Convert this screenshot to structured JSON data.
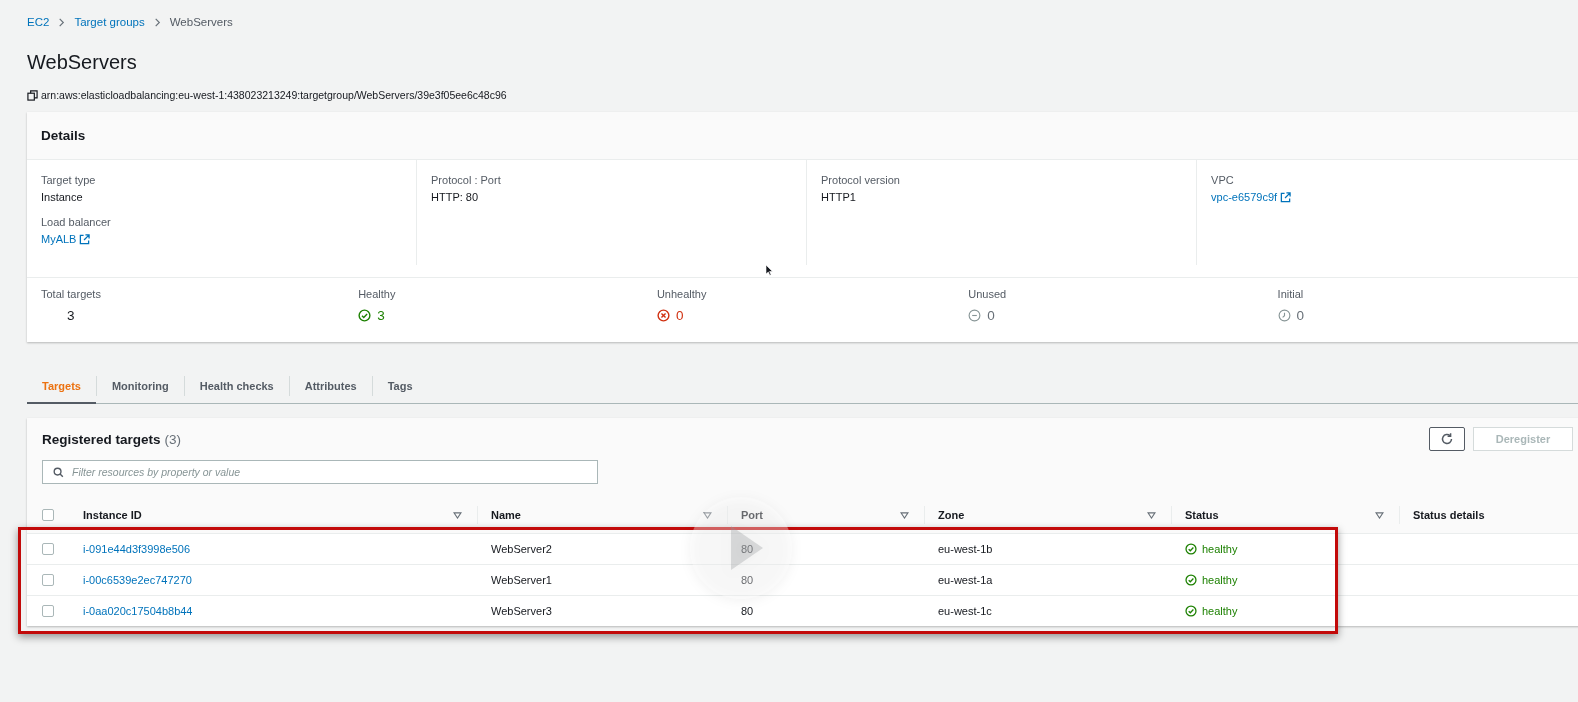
{
  "breadcrumbs": [
    {
      "label": "EC2",
      "kind": "link"
    },
    {
      "label": "Target groups",
      "kind": "link"
    },
    {
      "label": "WebServers",
      "kind": "current"
    }
  ],
  "title": "WebServers",
  "arn": "arn:aws:elasticloadbalancing:eu-west-1:438023213249:targetgroup/WebServers/39e3f05ee6c48c96",
  "details": {
    "title": "Details",
    "columns": [
      {
        "fields": [
          {
            "label": "Target type",
            "value": "Instance",
            "kind": "text"
          },
          {
            "label": "Load balancer",
            "value": "MyALB",
            "kind": "link"
          }
        ]
      },
      {
        "fields": [
          {
            "label": "Protocol : Port",
            "value": "HTTP: 80",
            "kind": "text"
          }
        ]
      },
      {
        "fields": [
          {
            "label": "Protocol version",
            "value": "HTTP1",
            "kind": "text"
          }
        ]
      },
      {
        "fields": [
          {
            "label": "VPC",
            "value": "vpc-e6579c9f",
            "kind": "link"
          }
        ]
      }
    ],
    "stats": [
      {
        "label": "Total targets",
        "value": "3",
        "kind": "total"
      },
      {
        "label": "Healthy",
        "value": "3",
        "kind": "healthy"
      },
      {
        "label": "Unhealthy",
        "value": "0",
        "kind": "unhealthy"
      },
      {
        "label": "Unused",
        "value": "0",
        "kind": "unused"
      },
      {
        "label": "Initial",
        "value": "0",
        "kind": "initial"
      }
    ]
  },
  "tabs": [
    {
      "label": "Targets",
      "selected": true
    },
    {
      "label": "Monitoring",
      "selected": false
    },
    {
      "label": "Health checks",
      "selected": false
    },
    {
      "label": "Attributes",
      "selected": false
    },
    {
      "label": "Tags",
      "selected": false
    }
  ],
  "targets": {
    "title": "Registered targets",
    "count": "(3)",
    "filter": {
      "placeholder": "Filter resources by property or value"
    },
    "deregister": {
      "label": "Deregister",
      "disabled": true
    },
    "select_all": {
      "checked": false
    },
    "columns": [
      {
        "label": "Instance ID",
        "filterable": true
      },
      {
        "label": "Name",
        "filterable": true
      },
      {
        "label": "Port",
        "filterable": true
      },
      {
        "label": "Zone",
        "filterable": true
      },
      {
        "label": "Status",
        "filterable": true
      },
      {
        "label": "Status details",
        "filterable": false
      }
    ],
    "rows": [
      {
        "checked": false,
        "instance_id": "i-091e44d3f3998e506",
        "name": "WebServer2",
        "port": "80",
        "zone": "eu-west-1b",
        "status": "healthy",
        "healthy": true
      },
      {
        "checked": false,
        "instance_id": "i-00c6539e2ec747270",
        "name": "WebServer1",
        "port": "80",
        "zone": "eu-west-1a",
        "status": "healthy",
        "healthy": true
      },
      {
        "checked": false,
        "instance_id": "i-0aa020c17504b8b44",
        "name": "WebServer3",
        "port": "80",
        "zone": "eu-west-1c",
        "status": "healthy",
        "healthy": true
      }
    ]
  }
}
